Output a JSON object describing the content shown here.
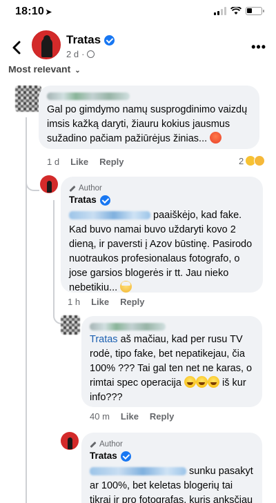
{
  "status_bar": {
    "time": "18:10"
  },
  "header": {
    "page_name": "Tratas",
    "subtitle": "2 d",
    "more_label": "•••"
  },
  "sort": {
    "label": "Most relevant"
  },
  "comments": [
    {
      "text": "Gal po gimdymo namų susprogdinimo vaizdų imsis kažką daryti, žiauru kokius jausmus sužadino pačiam pažiūrėjus žinias...",
      "time": "1 d",
      "like": "Like",
      "reply": "Reply",
      "reaction_count": "2"
    },
    {
      "badge": "Author",
      "name": "Tratas",
      "text": "paaiškėjo, kad fake. Kad buvo namai buvo uždaryti kovo 2 dieną, ir paversti į Azov būstinę. Pasirodo nuotraukos profesionalaus fotografo, o jose garsios blogerės ir tt. Jau nieko nebetikiu...",
      "time": "1 h",
      "like": "Like",
      "reply": "Reply"
    },
    {
      "mention": "Tratas",
      "text": "aš mačiau, kad per rusu TV rodė, tipo fake, bet nepatikejau, čia 100% ??? Tai gal ten net ne karas, o rimtai spec operacija",
      "text_after": "iš kur info???",
      "time": "40 m",
      "like": "Like",
      "reply": "Reply"
    },
    {
      "badge": "Author",
      "name": "Tratas",
      "text": "sunku pasakyt ar 100%, bet keletas blogerių tai tikrai ir pro fotografas, kuris anksčiau"
    }
  ],
  "colors": {
    "accent": "#1877f2",
    "bubble": "#f0f2f5",
    "secondary_text": "#65676b",
    "mention": "#1b5fb0"
  }
}
